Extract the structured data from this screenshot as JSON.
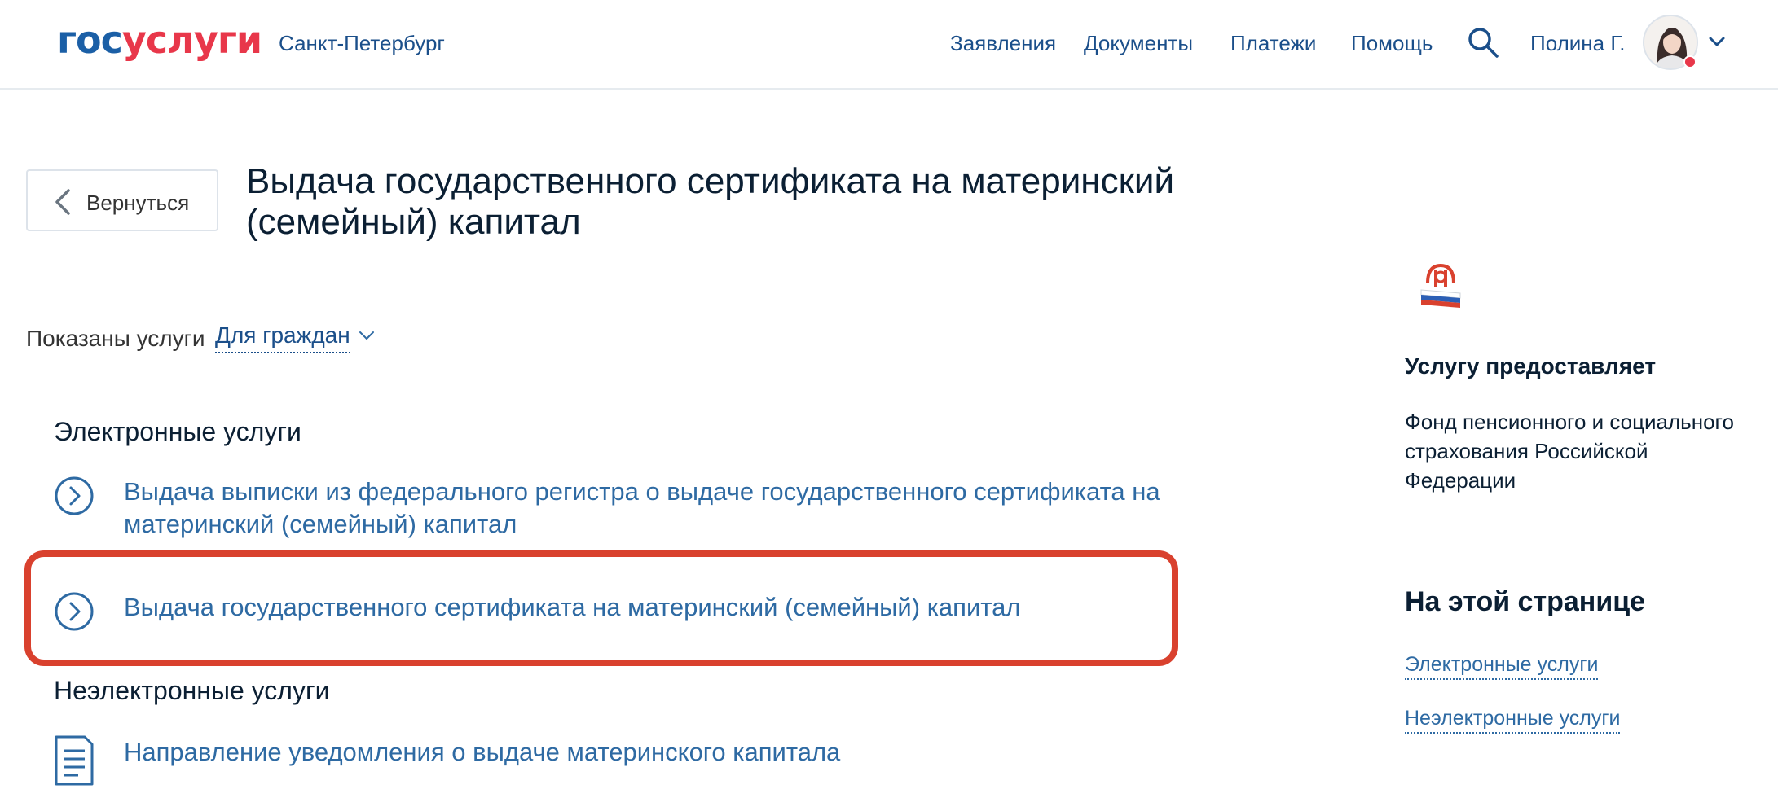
{
  "header": {
    "logo_part1": "гос",
    "logo_part2": "услуги",
    "city": "Санкт-Петербург",
    "nav": [
      "Заявления",
      "Документы",
      "Платежи",
      "Помощь"
    ],
    "user_name": "Полина Г."
  },
  "back_button": {
    "label": "Вернуться"
  },
  "page_title": "Выдача государственного сертификата на материнский (семейный) капитал",
  "filter": {
    "label": "Показаны услуги",
    "value": "Для граждан"
  },
  "electronic": {
    "title": "Электронные услуги",
    "items": [
      "Выдача выписки из федерального регистра о выдаче государственного сертификата на материнский (семейный) капитал",
      "Выдача государственного сертификата на материнский (семейный) капитал"
    ]
  },
  "non_electronic": {
    "title": "Неэлектронные услуги",
    "items": [
      "Направление уведомления о выдаче материнского капитала"
    ]
  },
  "sidebar": {
    "provider_title": "Услугу предоставляет",
    "provider_name": "Фонд пенсионного и социального страхования Российской Федерации",
    "on_page_title": "На этой странице",
    "links": [
      "Электронные услуги",
      "Неэлектронные услуги"
    ]
  },
  "colors": {
    "brand_blue": "#1b5fa6",
    "brand_red": "#e8374a",
    "link_blue": "#2e6aa3",
    "highlight_red": "#d9412e"
  }
}
